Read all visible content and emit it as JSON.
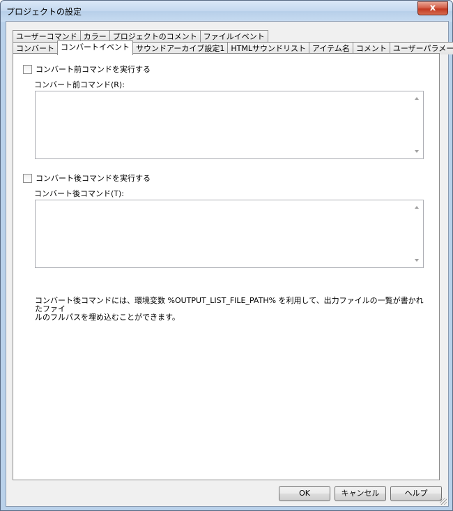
{
  "window": {
    "title": "プロジェクトの設定",
    "close_label": "x"
  },
  "tabs_back": [
    "ユーザーコマンド",
    "カラー",
    "プロジェクトのコメント",
    "ファイルイベント"
  ],
  "tabs_front": [
    "コンバート",
    "コンバートイベント",
    "サウンドアーカイブ設定1",
    "HTMLサウンドリスト",
    "アイテム名",
    "コメント",
    "ユーザーパラメータ"
  ],
  "active_tab": "コンバートイベント",
  "pre": {
    "checkbox_label": "コンバート前コマンドを実行する",
    "checked": false,
    "field_label": "コンバート前コマンド(R):",
    "value": ""
  },
  "post": {
    "checkbox_label": "コンバート後コマンドを実行する",
    "checked": false,
    "field_label": "コンバート後コマンド(T):",
    "value": ""
  },
  "note": {
    "line1": "コンバート後コマンドには、環境変数 %OUTPUT_LIST_FILE_PATH% を利用して、出力ファイルの一覧が書かれたファイ",
    "line2": "ルのフルパスを埋め込むことができます。"
  },
  "buttons": {
    "ok": "OK",
    "cancel": "キャンセル",
    "help": "ヘルプ"
  }
}
